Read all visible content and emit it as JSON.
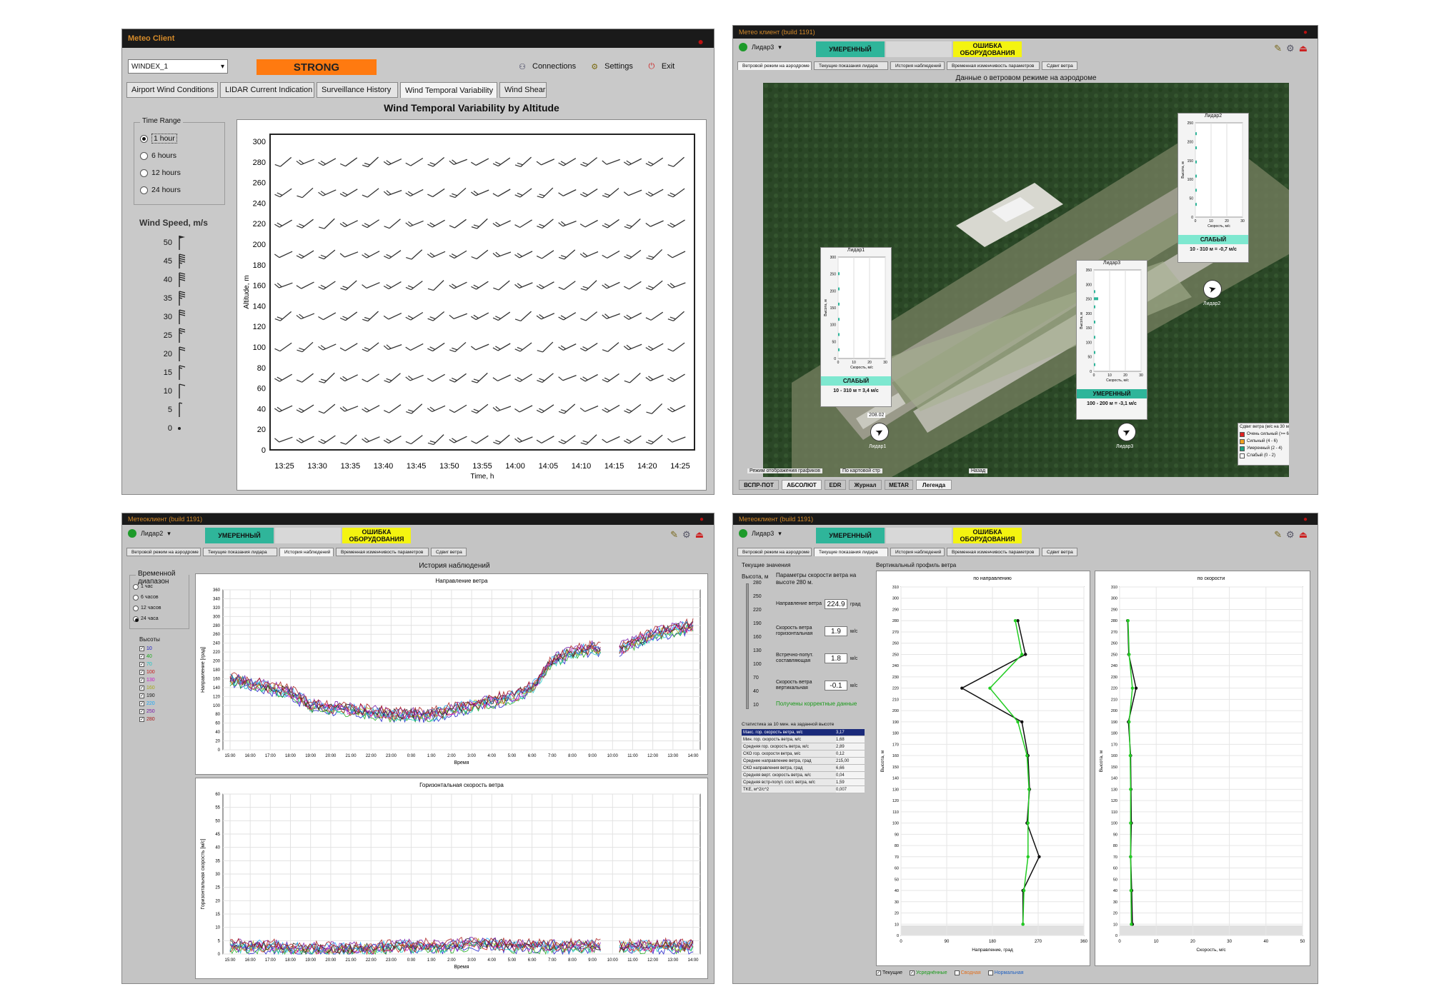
{
  "w1": {
    "title": "Meteo Client",
    "dropdown_value": "WINDEX_1",
    "alert": "STRONG",
    "toolbar": {
      "connections": "Connections",
      "settings": "Settings",
      "exit": "Exit"
    },
    "tabs": [
      "Airport Wind Conditions",
      "LIDAR Current Indication",
      "Surveillance History",
      "Wind Temporal Variability",
      "Wind Shear"
    ],
    "active_tab": 3,
    "time_range": {
      "title": "Time Range",
      "options": [
        "1 hour",
        "6 hours",
        "12 hours",
        "24 hours"
      ],
      "selected": 0
    },
    "legend_title": "Wind Speed, m/s",
    "legend_values": [
      "50",
      "45",
      "40",
      "35",
      "30",
      "25",
      "20",
      "15",
      "10",
      "5",
      "0"
    ],
    "chart_data": {
      "type": "scatter",
      "title": "Wind Temporal Variability by Altitude",
      "xlabel": "Time, h",
      "ylabel": "Altitude, m",
      "x_ticks": [
        "13:25",
        "13:30",
        "13:35",
        "13:40",
        "13:45",
        "13:50",
        "13:55",
        "14:00",
        "14:05",
        "14:10",
        "14:15",
        "14:20",
        "14:25"
      ],
      "y_ticks": [
        0,
        20,
        40,
        60,
        80,
        100,
        120,
        140,
        160,
        180,
        200,
        220,
        240,
        260,
        280,
        300
      ],
      "ylim": [
        0,
        300
      ],
      "altitudes": [
        10,
        40,
        70,
        100,
        130,
        160,
        190,
        220,
        250,
        280
      ],
      "time_steps": 19,
      "marker": "wind-barb"
    }
  },
  "w2": {
    "title": "Метео клиент (build 1191)",
    "lidar_select": "Лидар3",
    "status_moderate": "УМЕРЕННЫЙ",
    "status_error": "ОШИБКА ОБОРУДОВАНИЯ",
    "tabs": [
      "Ветровой режим на аэродроме",
      "Текущие показания лидара",
      "История наблюдений",
      "Временная изменчивость параметров",
      "Сдвиг ветра"
    ],
    "active_tab": 0,
    "map_title": "Данные о ветровом режиме на аэродроме",
    "lidar1": {
      "name": "Лидар1",
      "ylabel": "Высота, м",
      "xlabel": "Скорость, м/с",
      "x_ticks": [
        "0",
        "10",
        "20",
        "30"
      ],
      "y_ticks": [
        "300",
        "250",
        "200",
        "150",
        "100",
        "50",
        "0"
      ],
      "level": "СЛАБЫЙ",
      "range": "10 - 310 м = 3,4 м/с",
      "label": "Лидар1",
      "dir": "208.02"
    },
    "lidar2": {
      "name": "Лидар2",
      "ylabel": "Высота, м",
      "xlabel": "Скорость, м/с",
      "x_ticks": [
        "0",
        "10",
        "20",
        "30"
      ],
      "y_ticks": [
        "250",
        "200",
        "150",
        "100",
        "50",
        "0"
      ],
      "level": "СЛАБЫЙ",
      "range": "10 - 310 м = -0,7 м/с",
      "label": "Лидар2"
    },
    "lidar3": {
      "name": "Лидар3",
      "ylabel": "Высота, м",
      "xlabel": "Скорость, м/с",
      "x_ticks": [
        "0",
        "10",
        "20",
        "30"
      ],
      "y_ticks": [
        "350",
        "300",
        "250",
        "200",
        "150",
        "100",
        "50",
        "0"
      ],
      "level": "УМЕРЕННЫЙ",
      "range": "100 - 200 м = -3,1 м/с",
      "label": "Лидар3"
    },
    "shear_legend": {
      "title": "Сдвиг ветра (м/с на 30 м)",
      "items": [
        {
          "label": "Очень сильный (>= 6)",
          "color": "#e02020"
        },
        {
          "label": "Сильный (4 - 6)",
          "color": "#f0a020"
        },
        {
          "label": "Умеренный (2 - 4)",
          "color": "#20a080"
        },
        {
          "label": "Слабый (0 - 2)",
          "color": "#ffffff"
        }
      ]
    },
    "bottom_links": [
      "Режим отображения графиков",
      "По картовой стр",
      "Назад"
    ],
    "bottom_tabs": [
      "ВСПР-ПОТ",
      "АБСОЛЮТ",
      "EDR",
      "Журнал",
      "METAR",
      "Легенда"
    ]
  },
  "w3": {
    "title": "Метеоклиент (build 1191)",
    "lidar_select": "Лидар2",
    "status_moderate": "УМЕРЕННЫЙ",
    "status_error": "ОШИБКА ОБОРУДОВАНИЯ",
    "tabs": [
      "Ветровой режим на аэродроме",
      "Текущие показания лидара",
      "История наблюдений",
      "Временная изменчивость параметров",
      "Сдвиг ветра"
    ],
    "active_tab": 2,
    "range_title": "Временной диапазон",
    "range_options": [
      "1 час",
      "6 часов",
      "12 часов",
      "24 часа"
    ],
    "range_selected": 3,
    "heights_title": "Высоты",
    "heights": [
      {
        "h": "10",
        "c": "#1818c8"
      },
      {
        "h": "40",
        "c": "#18a818"
      },
      {
        "h": "70",
        "c": "#18c8c8"
      },
      {
        "h": "100",
        "c": "#c81818"
      },
      {
        "h": "130",
        "c": "#c818c8"
      },
      {
        "h": "160",
        "c": "#a8a818"
      },
      {
        "h": "190",
        "c": "#181818"
      },
      {
        "h": "220",
        "c": "#18a8f8"
      },
      {
        "h": "250",
        "c": "#7818a8"
      },
      {
        "h": "280",
        "c": "#a81818"
      }
    ],
    "panel_title": "История наблюдений",
    "chart_data": [
      {
        "type": "line",
        "title": "Направление ветра",
        "ylabel": "Направление [град]",
        "xlabel": "Время",
        "ylim": [
          0,
          360
        ],
        "y_ticks": [
          0,
          20,
          40,
          60,
          80,
          100,
          120,
          140,
          160,
          180,
          200,
          220,
          240,
          260,
          280,
          300,
          320,
          340,
          360
        ],
        "x_ticks": [
          "15:00",
          "16:00",
          "17:00",
          "18:00",
          "19:00",
          "20:00",
          "21:00",
          "22:00",
          "23:00",
          "0:00",
          "1:00",
          "2:00",
          "3:00",
          "4:00",
          "5:00",
          "6:00",
          "7:00",
          "8:00",
          "9:00",
          "10:00",
          "11:00",
          "12:00",
          "13:00",
          "14:00"
        ],
        "trend": [
          160,
          150,
          140,
          130,
          100,
          95,
          90,
          85,
          80,
          80,
          80,
          90,
          100,
          110,
          120,
          140,
          200,
          220,
          230,
          220,
          240,
          260,
          270,
          280
        ]
      },
      {
        "type": "line",
        "title": "Горизонтальная скорость ветра",
        "ylabel": "Горизонтальная скорость [м/с]",
        "xlabel": "Время",
        "ylim": [
          0,
          60
        ],
        "y_ticks": [
          0,
          5,
          10,
          15,
          20,
          25,
          30,
          35,
          40,
          45,
          50,
          55,
          60
        ],
        "x_ticks": [
          "15:00",
          "16:00",
          "17:00",
          "18:00",
          "19:00",
          "20:00",
          "21:00",
          "22:00",
          "23:00",
          "0:00",
          "1:00",
          "2:00",
          "3:00",
          "4:00",
          "5:00",
          "6:00",
          "7:00",
          "8:00",
          "9:00",
          "10:00",
          "11:00",
          "12:00",
          "13:00",
          "14:00"
        ],
        "trend": [
          3,
          3,
          3,
          2,
          2,
          2,
          2,
          2,
          3,
          3,
          3,
          3,
          4,
          4,
          3,
          3,
          3,
          3,
          3,
          3,
          3,
          3,
          3,
          3
        ]
      }
    ]
  },
  "w4": {
    "title": "Метеоклиент (build 1191)",
    "lidar_select": "Лидар3",
    "status_moderate": "УМЕРЕННЫЙ",
    "status_error": "ОШИБКА ОБОРУДОВАНИЯ",
    "tabs": [
      "Ветровой режим на аэродроме",
      "Текущие показания лидара",
      "История наблюдений",
      "Временная изменчивость параметров",
      "Сдвиг ветра"
    ],
    "active_tab": 1,
    "current_title": "Текущие значения",
    "height_label": "Высота, м",
    "slider_ticks": [
      "280",
      "250",
      "220",
      "190",
      "160",
      "130",
      "100",
      "70",
      "40",
      "10"
    ],
    "params_title": "Параметры скорости ветра на высоте 280 м.",
    "params": [
      {
        "label": "Направление ветра",
        "value": "224.9",
        "unit": "град"
      },
      {
        "label": "Скорость ветра горизонтальная",
        "value": "1.9",
        "unit": "м/с"
      },
      {
        "label": "Встречно-попут. составляющая",
        "value": "1.8",
        "unit": "м/с"
      },
      {
        "label": "Скорость ветра вертикальная",
        "value": "-0.1",
        "unit": "м/с"
      }
    ],
    "ok_msg": "Получены корректные данные",
    "stats_title": "Статистика за 10 мин. на заданной высоте",
    "stats": [
      [
        "Макс. гор. скорость ветра, м/с",
        "3,17"
      ],
      [
        "Мин. гор. скорость ветра, м/с",
        "1,68"
      ],
      [
        "Средняя гор. скорость ветра, м/с",
        "2,89"
      ],
      [
        "СКО гор. скорости ветра, м/с",
        "0,12"
      ],
      [
        "Среднее направление ветра, град",
        "215,00"
      ],
      [
        "СКО направления ветра, град",
        "6,66"
      ],
      [
        "Средняя верт. скорость ветра, м/с",
        "0,04"
      ],
      [
        "Средняя встр-попут. сост. ветра, м/с",
        "1,59"
      ],
      [
        "TKE, м^2/с^2",
        "0,007"
      ]
    ],
    "vprofile_title": "Вертикальный профиль ветра",
    "checks": [
      "Текущие",
      "Усреднённые",
      "Сводная",
      "Нормальная"
    ],
    "chart_data": [
      {
        "type": "line",
        "title": "по направлению",
        "xlabel": "Направление, град",
        "ylabel": "Высота, м",
        "xlim": [
          0,
          360
        ],
        "x_ticks": [
          0,
          90,
          180,
          270,
          360
        ],
        "ylim": [
          0,
          310
        ],
        "y_ticks": [
          0,
          10,
          20,
          30,
          40,
          50,
          60,
          70,
          80,
          90,
          100,
          110,
          120,
          130,
          140,
          150,
          160,
          170,
          180,
          190,
          200,
          210,
          220,
          230,
          240,
          250,
          260,
          270,
          280,
          290,
          300,
          310
        ],
        "series": [
          {
            "values_h": [
              10,
              40,
              70,
              100,
              130,
              160,
              190,
              220,
              250,
              280
            ],
            "values_x": [
              240,
              240,
              272,
              248,
              253,
              250,
              238,
              120,
              245,
              230
            ]
          },
          {
            "values_h": [
              10,
              40,
              70,
              100,
              130,
              160,
              190,
              220,
              250,
              280
            ],
            "values_x": [
              240,
              242,
              250,
              250,
              252,
              248,
              230,
              175,
              238,
              225
            ]
          }
        ]
      },
      {
        "type": "line",
        "title": "по скорости",
        "xlabel": "Скорость, м/с",
        "ylabel": "Высота, м",
        "xlim": [
          0,
          50
        ],
        "x_ticks": [
          0,
          10,
          20,
          30,
          40,
          50
        ],
        "ylim": [
          0,
          310
        ],
        "y_ticks": [
          0,
          10,
          20,
          30,
          40,
          50,
          60,
          70,
          80,
          90,
          100,
          110,
          120,
          130,
          140,
          150,
          160,
          170,
          180,
          190,
          200,
          210,
          220,
          230,
          240,
          250,
          260,
          270,
          280,
          290,
          300,
          310
        ],
        "series": [
          {
            "values_h": [
              10,
              40,
              70,
              100,
              130,
              160,
              190,
              220,
              250,
              280
            ],
            "values_x": [
              3.5,
              3.3,
              3.0,
              3.2,
              3.1,
              3.0,
              2.4,
              4.5,
              2.5,
              2.2
            ]
          },
          {
            "values_h": [
              10,
              40,
              70,
              100,
              130,
              160,
              190,
              220,
              250,
              280
            ],
            "values_x": [
              3.2,
              3.1,
              3.0,
              3.0,
              3.0,
              2.9,
              2.6,
              3.5,
              2.6,
              2.3
            ]
          }
        ]
      }
    ]
  }
}
